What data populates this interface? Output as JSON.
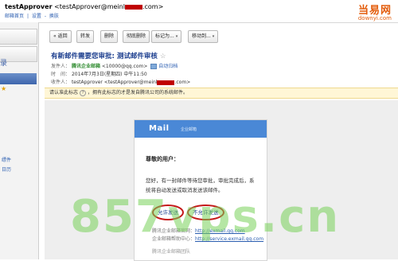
{
  "header": {
    "account_name": "testApprover",
    "account_email_prefix": "<testApprover@meinl",
    "account_email_suffix": ".com>",
    "links": [
      "邮箱首页",
      "|",
      "设置",
      "-",
      "换肤"
    ]
  },
  "watermark_brand": {
    "name": "当易网",
    "domain": "downyi.com"
  },
  "sidebar": {
    "items": [
      {
        "label": "录"
      },
      {
        "label": "★"
      },
      {
        "label": "缥件"
      },
      {
        "label": "日历"
      }
    ]
  },
  "toolbar": {
    "back_label": "« 返回",
    "forward_label": "转发",
    "delete_label": "删除",
    "purge_label": "彻底删除",
    "mark_label": "标记为...",
    "move_label": "移动到...",
    "arrow": "▾"
  },
  "mail": {
    "subject": "有新邮件需要您审批: 测试邮件审核",
    "star": "☆",
    "from_label": "发件人：",
    "from_name": "腾讯企业邮箱",
    "from_addr": "<10000@qq.com>",
    "whitelist_label": "自动归档",
    "time_label": "时　间：",
    "time_value": "2014年7月3日(星期四) 中午11:50",
    "to_label": "收件人：",
    "to_value": "testApprover <testApprover@meinl"
  },
  "notice": {
    "text_a": "请认准此标志",
    "text_b": "，拥有此标志的才是发自腾讯公司的系统邮件。"
  },
  "card": {
    "logo": "Mail",
    "logo_sub": "企业邮箱",
    "greeting": "尊敬的用户：",
    "paragraph": "您好，有一封邮件等待您审批，审批完成后，系统将自动发送或取消发送该邮件。",
    "allow_label": "允许发送",
    "deny_label": "不允许发送",
    "foot1_label": "腾讯企业邮箱官网：",
    "foot1_link": "http://exmail.qq.com",
    "foot2_label": "企业邮箱帮助中心：",
    "foot2_link": "http://service.exmail.qq.com",
    "foot3": "腾讯企业邮箱团队"
  },
  "watermark": {
    "text": "857vps.cn"
  }
}
